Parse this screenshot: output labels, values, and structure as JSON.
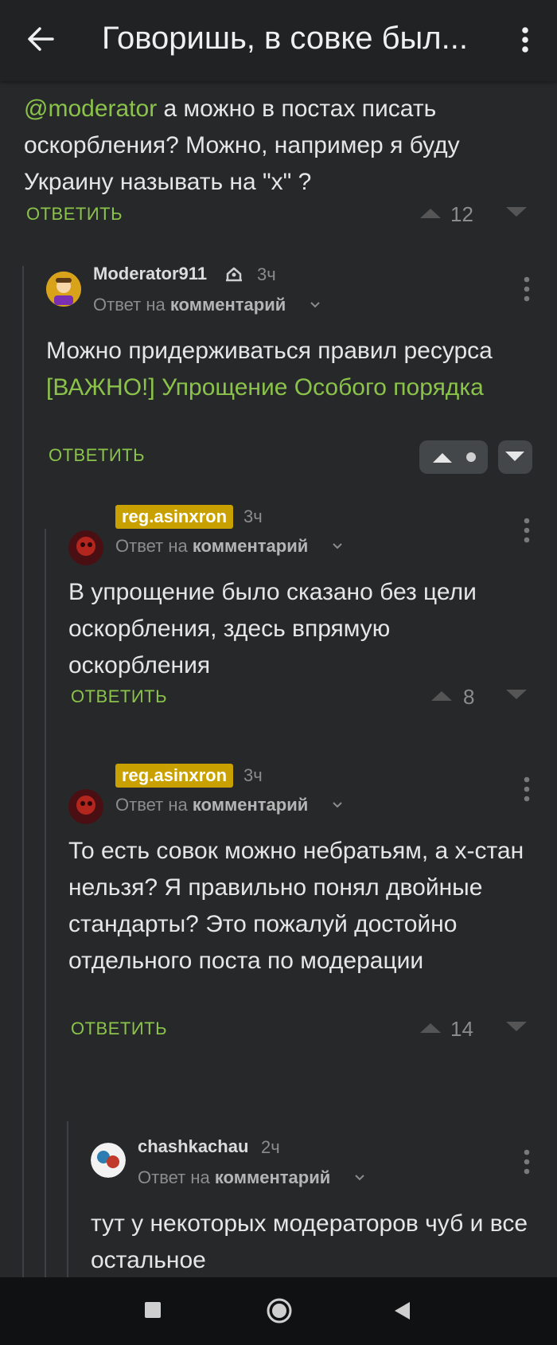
{
  "app_bar": {
    "title": "Говоришь, в совке был..."
  },
  "comments": [
    {
      "mention": "@moderator",
      "text": " а можно в постах писать оскорбления? Можно, например я буду Украину называть на \"х\" ?",
      "reply_label": "ОТВЕТИТЬ",
      "votes": "12"
    },
    {
      "author": "Moderator911",
      "time": "3ч",
      "reply_to_prefix": "Ответ на ",
      "reply_to_target": "комментарий",
      "text_before": "Можно придерживаться правил ресурса ",
      "link": "[ВАЖНО!] Упрощение Особого порядка",
      "reply_label": "ОТВЕТИТЬ"
    },
    {
      "author": "reg.asinxron",
      "time": "3ч",
      "reply_to_prefix": "Ответ на ",
      "reply_to_target": "комментарий",
      "text": "В упрощение было сказано без цели оскорбления, здесь впрямую оскорбления",
      "reply_label": "ОТВЕТИТЬ",
      "votes": "8"
    },
    {
      "author": "reg.asinxron",
      "time": "3ч",
      "reply_to_prefix": "Ответ на ",
      "reply_to_target": "комментарий",
      "text": "То есть совок можно небратьям, а х-стан нельзя? Я правильно понял двойные стандарты? Это пожалуй достойно отдельного поста по модерации",
      "reply_label": "ОТВЕТИТЬ",
      "votes": "14"
    },
    {
      "author": "chashkachau",
      "time": "2ч",
      "reply_to_prefix": "Ответ на ",
      "reply_to_target": "комментарий",
      "text": "тут у некоторых модераторов чуб и все остальное"
    }
  ],
  "colors": {
    "accent": "#8bc34a",
    "background": "#26282a",
    "badge": "#c8a100"
  },
  "icons": [
    "back-arrow-icon",
    "more-vert-icon",
    "upvote-icon",
    "downvote-icon",
    "moderator-badge-icon",
    "chevron-down-icon",
    "nav-recents-icon",
    "nav-home-icon",
    "nav-back-icon"
  ]
}
